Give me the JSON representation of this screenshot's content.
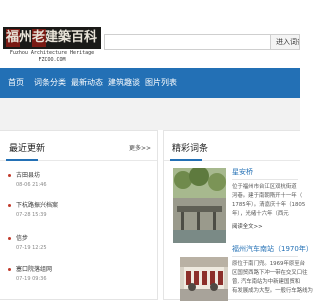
{
  "header": {
    "logo_chars": [
      "福",
      "州",
      "老",
      "建",
      "築",
      "百",
      "科"
    ],
    "logo_subtitle": "Fuzhou Architecture Heritage",
    "logo_url": "FZCOO.COM",
    "search_placeholder": "",
    "search_button_label": "进入词条"
  },
  "nav": {
    "items": [
      {
        "label": "首页"
      },
      {
        "label": "词条分类"
      },
      {
        "label": "最新动态"
      },
      {
        "label": "建筑趣谈"
      },
      {
        "label": "图片列表"
      }
    ]
  },
  "latest": {
    "title": "最近更新",
    "more": "更多>>",
    "items": [
      {
        "title": "古田县坊",
        "time": "08-06 21:46"
      },
      {
        "title": "下杭路振兴档案",
        "time": "07-28 15:39"
      },
      {
        "title": "信步",
        "time": "07-19 12:25"
      },
      {
        "title": "塞口院落组网",
        "time": "07-19 09:36"
      }
    ]
  },
  "featured": {
    "title": "精彩词条",
    "items": [
      {
        "title": "星安桥",
        "lines": [
          "位于福州市台江区双杭街道",
          "河巷。建于南朝隋开十一年（",
          "1785年）。清嘉庆十年（1805",
          "年），光绪十六年（西元"
        ],
        "link": "阅读全文>>"
      },
      {
        "title": "福州汽车南站（1970年）",
        "lines": [
          "原位于南门兜。1969年原至台",
          "区国贸西路下冲一带在交叉口往",
          "曾, 汽车南站为中新建国贸和",
          "有发展成为大型。一般行车路线为"
        ]
      }
    ]
  },
  "colors": {
    "nav": "#2370b5",
    "link": "#2370b5",
    "logo_banner": "#1a1a18",
    "logo_red": "#7a1a14",
    "update_dot": "#c0392b"
  }
}
